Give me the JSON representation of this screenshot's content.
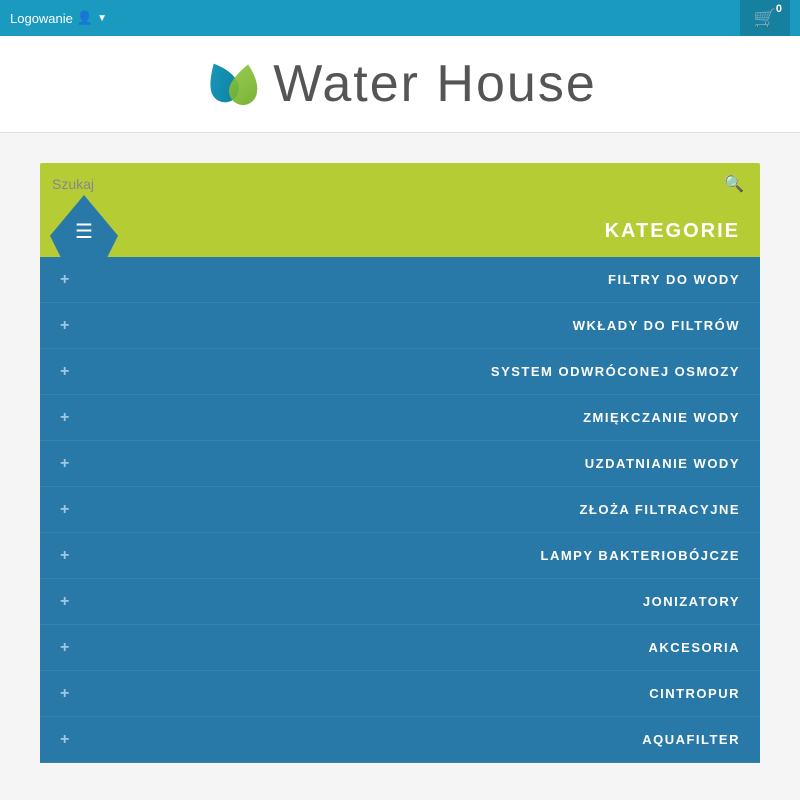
{
  "topbar": {
    "login_label": "Logowanie",
    "cart_count": "0"
  },
  "header": {
    "logo_text": "Water House"
  },
  "search": {
    "placeholder": "Szukaj"
  },
  "categories": {
    "title": "KATEGORIE",
    "items": [
      {
        "label": "FILTRY DO WODY"
      },
      {
        "label": "WKŁADY DO FILTRÓW"
      },
      {
        "label": "SYSTEM ODWRÓCONEJ OSMOZY"
      },
      {
        "label": "ZMIĘKCZANIE WODY"
      },
      {
        "label": "UZDATNIANIE WODY"
      },
      {
        "label": "ZŁOŻA FILTRACYJNE"
      },
      {
        "label": "LAMPY BAKTERIOBÓJCZE"
      },
      {
        "label": "JONIZATORY"
      },
      {
        "label": "AKCESORIA"
      },
      {
        "label": "CINTROPUR"
      },
      {
        "label": "AQUAFILTER"
      }
    ],
    "plus_symbol": "+"
  },
  "colors": {
    "topbar_bg": "#1a9abf",
    "green": "#b5cc35",
    "blue": "#2878a8"
  }
}
